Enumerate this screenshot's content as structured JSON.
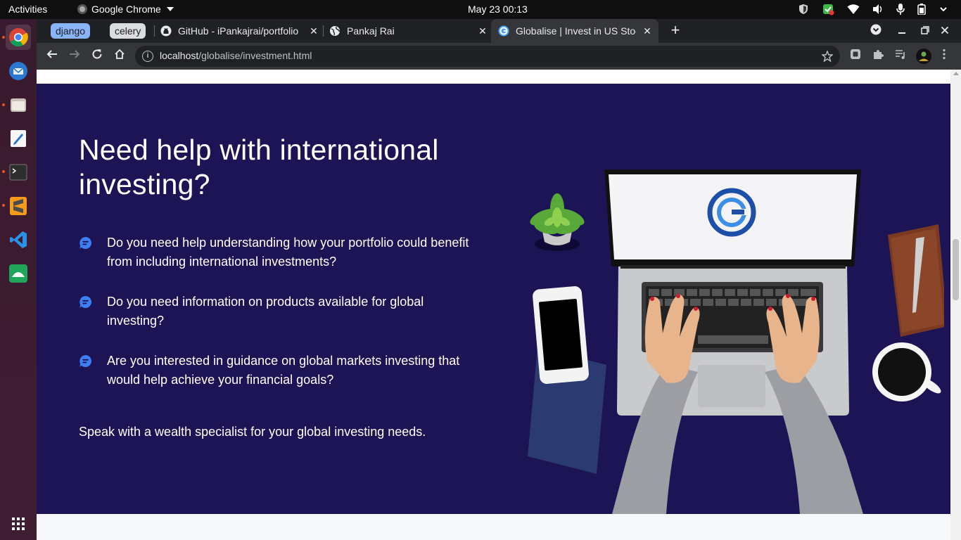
{
  "system_bar": {
    "activities": "Activities",
    "app_name": "Google Chrome",
    "clock": "May 23  00:13"
  },
  "dock": {
    "items": [
      "chrome-icon",
      "thunderbird-icon",
      "files-icon",
      "text-editor-icon",
      "terminal-icon",
      "sublime-text-icon",
      "vscode-icon",
      "anydesk-icon"
    ],
    "show_apps": "app-grid-icon"
  },
  "browser": {
    "tab_groups": [
      "django",
      "celery"
    ],
    "tabs": [
      {
        "title": "GitHub - iPankajrai/portfolio",
        "icon": "github-icon",
        "active": false
      },
      {
        "title": "Pankaj Rai",
        "icon": "globe-icon",
        "active": false
      },
      {
        "title": "Globalise | Invest in US Stocks",
        "icon": "globalise-icon",
        "active": true
      }
    ],
    "url_host": "localhost",
    "url_path": "/globalise/investment.html"
  },
  "page": {
    "heading": "Need help with international investing?",
    "questions": [
      "Do you need help understanding how your portfolio could benefit from including international investments?",
      "Do you need information on products available for global investing?",
      "Are you interested in guidance on global markets investing that would help achieve your financial goals?"
    ],
    "cta_text": "Speak with a wealth specialist for your global investing needs."
  },
  "colors": {
    "section_bg": "#1c1454",
    "icon_accent": "#3d7ff5",
    "tab_group_django": "#8ab4f8",
    "tab_group_celery": "#dadce0"
  }
}
